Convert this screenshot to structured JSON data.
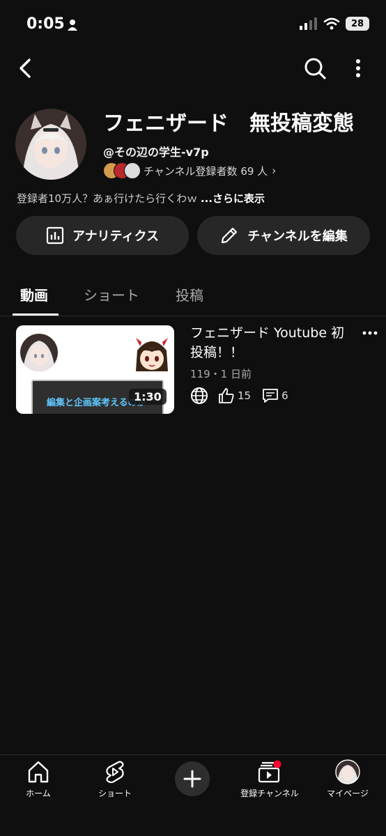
{
  "status_bar": {
    "time": "0:05",
    "battery": "28"
  },
  "channel": {
    "name": "フェニザード　無投稿変態",
    "handle": "@その辺の学生-v7p",
    "subscribers": "チャンネル登録者数 69 人",
    "description": "登録者10万人？あぁ行けたら行くわｗ",
    "description_more": "...さらに表示"
  },
  "actions": {
    "analytics": "アナリティクス",
    "edit": "チャンネルを編集"
  },
  "tabs": [
    {
      "label": "動画",
      "active": true
    },
    {
      "label": "ショート",
      "active": false
    },
    {
      "label": "投稿",
      "active": false
    }
  ],
  "videos": [
    {
      "title": "フェニザード Youtube 初投稿！！",
      "meta": "119・1 日前",
      "duration": "1:30",
      "likes": "15",
      "comments": "6",
      "thumbnail_caption": "編集と企画案考えるのが"
    }
  ],
  "nav": [
    {
      "label": "ホーム",
      "icon": "home-icon"
    },
    {
      "label": "ショート",
      "icon": "shorts-icon"
    },
    {
      "label": "",
      "icon": "create-icon"
    },
    {
      "label": "登録チャンネル",
      "icon": "subscriptions-icon"
    },
    {
      "label": "マイページ",
      "icon": "avatar"
    }
  ],
  "colors": {
    "background": "#0f0f0f",
    "button": "#272727",
    "accent_red": "#ff0033"
  }
}
